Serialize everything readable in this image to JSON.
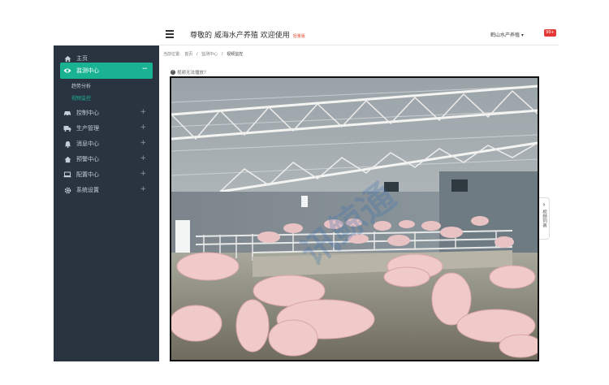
{
  "header": {
    "welcome_title": "尊敬的  威海水产养殖 欢迎使用",
    "welcome_tag": "轻量版",
    "user_menu": "鹤山水产养殖 ▾",
    "notification_badge": "99+"
  },
  "sidebar": {
    "items": [
      {
        "label": "主页",
        "icon": "home-icon"
      },
      {
        "label": "监测中心",
        "icon": "eye-icon",
        "active": true
      },
      {
        "label": "控制中心",
        "icon": "car-icon"
      },
      {
        "label": "生产管理",
        "icon": "truck-icon"
      },
      {
        "label": "消息中心",
        "icon": "bell-icon"
      },
      {
        "label": "预警中心",
        "icon": "home-alert-icon"
      },
      {
        "label": "配置中心",
        "icon": "laptop-icon"
      },
      {
        "label": "系统设置",
        "icon": "gear-icon"
      }
    ],
    "sub_items": [
      {
        "label": "趋势分析"
      },
      {
        "label": "视频监控",
        "current": true
      }
    ],
    "expand_symbol": "+",
    "collapse_symbol": "−"
  },
  "breadcrumb": {
    "prefix": "当前位置:",
    "items": [
      "首页",
      "监测中心",
      "视频监控"
    ],
    "separator": "/"
  },
  "help": {
    "icon_glyph": "?",
    "text": "视频无法播放？"
  },
  "side_tab": {
    "arrow": "›",
    "label": "视频列表"
  },
  "video": {
    "watermark": "讯鲸通"
  },
  "colors": {
    "sidebar_bg": "#2a3441",
    "accent": "#19b394",
    "badge": "#e53935"
  }
}
